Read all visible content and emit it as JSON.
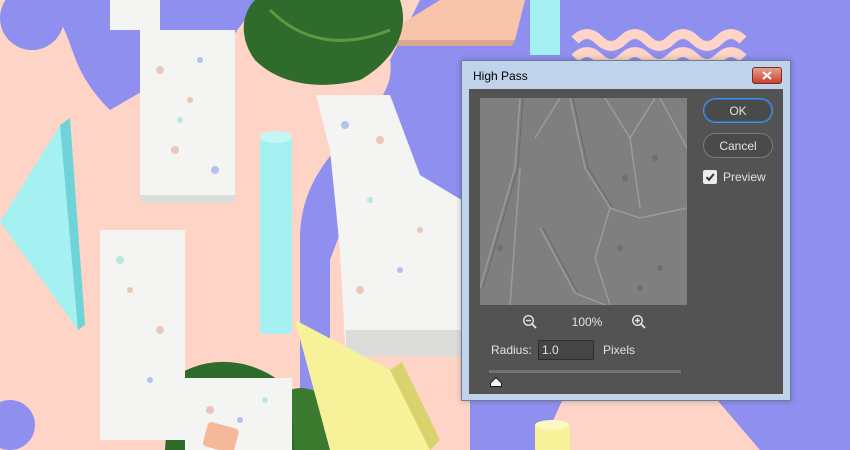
{
  "dialog": {
    "title": "High Pass",
    "ok_label": "OK",
    "cancel_label": "Cancel",
    "preview_label": "Preview",
    "preview_checked": true,
    "zoom_level": "100%",
    "radius_label": "Radius:",
    "radius_value": "1.0",
    "units_label": "Pixels",
    "radius_slider_value": 1.0
  },
  "icons": {
    "close": "close-icon",
    "zoom_out": "zoom-out-icon",
    "zoom_in": "zoom-in-icon",
    "checkbox": "checkmark-icon",
    "slider_thumb": "slider-thumb-icon"
  },
  "colors": {
    "background": "#8f8ff0",
    "peach_shape": "#fed4c6",
    "cyan_shape": "#a5f0f0",
    "yellow_shape": "#f7f29a",
    "dialog_frame": "#bfd3ea",
    "dialog_client": "#535353",
    "accent_button_border": "#4a8fe3",
    "close_button": "#c8412c"
  }
}
